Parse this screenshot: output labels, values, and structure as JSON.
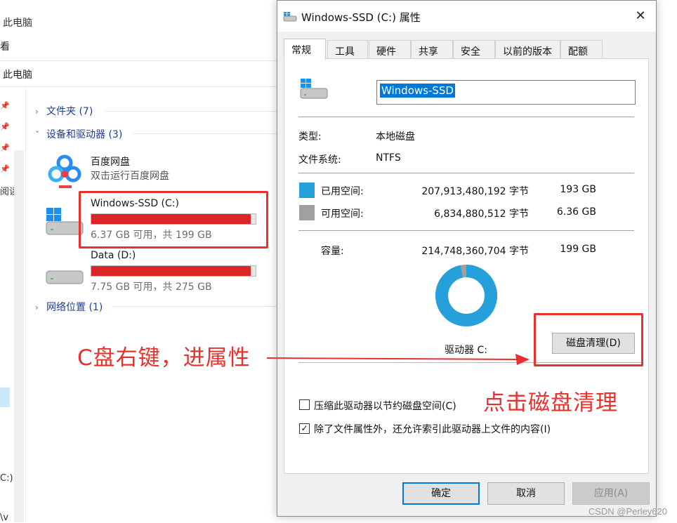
{
  "explorer": {
    "window_title": "此电脑",
    "ribbon_tab": "查看",
    "ribbon_tab_partial": "看",
    "address": "此电脑",
    "nav_fragments": [
      "阅读",
      "C:)",
      "\\v"
    ],
    "groups": [
      {
        "label": "文件夹",
        "count": "(7)",
        "expanded": false
      },
      {
        "label": "设备和驱动器",
        "count": "(3)",
        "expanded": true
      },
      {
        "label": "网络位置",
        "count": "(1)",
        "expanded": false
      }
    ],
    "apps": [
      {
        "name": "百度网盘",
        "subtitle": "双击运行百度网盘",
        "icon": "baidu-netdisk-icon"
      }
    ],
    "drives": [
      {
        "name": "Windows-SSD (C:)",
        "free_text": "6.37 GB 可用，共 199 GB",
        "used_fraction": 0.968,
        "icon": "windows-drive-icon"
      },
      {
        "name": "Data (D:)",
        "free_text": "7.75 GB 可用，共 275 GB",
        "used_fraction": 0.972,
        "icon": "drive-icon"
      }
    ]
  },
  "dialog": {
    "title": "Windows-SSD (C:) 属性",
    "close_glyph": "✕",
    "tabs": [
      "常规",
      "工具",
      "硬件",
      "共享",
      "安全",
      "以前的版本",
      "配额"
    ],
    "active_tab": "常规",
    "drive_name_value": "Windows-SSD",
    "type_label": "类型:",
    "type_value": "本地磁盘",
    "fs_label": "文件系统:",
    "fs_value": "NTFS",
    "used_label": "已用空间:",
    "used_bytes": "207,913,480,192 字节",
    "used_size": "193 GB",
    "free_label": "可用空间:",
    "free_bytes": "6,834,880,512 字节",
    "free_size": "6.36 GB",
    "capacity_label": "容量:",
    "capacity_bytes": "214,748,360,704 字节",
    "capacity_size": "199 GB",
    "used_fraction": 0.968,
    "drive_label": "驱动器 C:",
    "cleanup_button": "磁盘清理(D)",
    "compress_label": "压缩此驱动器以节约磁盘空间(C)",
    "compress_checked": false,
    "index_label": "除了文件属性外，还允许索引此驱动器上文件的内容(I)",
    "index_checked": true,
    "ok_button": "确定",
    "cancel_button": "取消",
    "apply_button": "应用(A)",
    "colors": {
      "used": "#26a0da",
      "free": "#a0a0a0",
      "accent": "#0078d7"
    }
  },
  "annotations": {
    "right_click_hint": "C盘右键，进属性",
    "cleanup_hint": "点击磁盘清理",
    "color": "#e8302c"
  },
  "watermark": "CSDN @Perley620"
}
